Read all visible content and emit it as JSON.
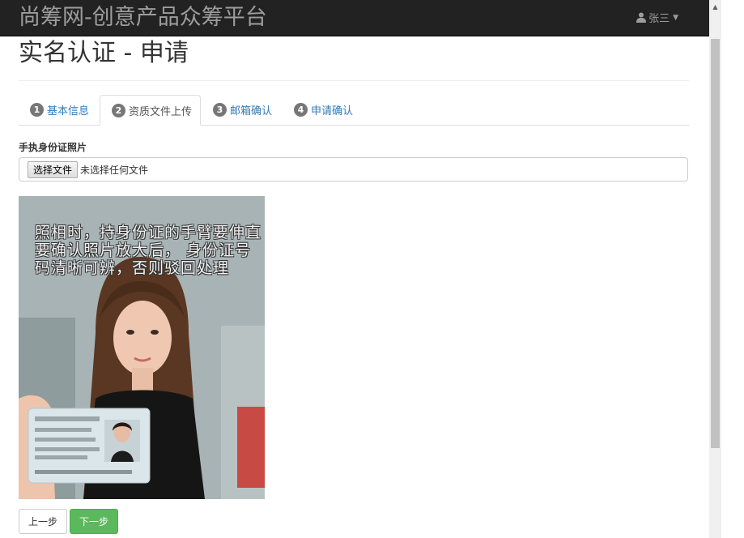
{
  "navbar": {
    "brand": "尚筹网-创意产品众筹平台",
    "user_name": "张三",
    "user_icon": "user-icon",
    "caret_icon": "caret-down-icon"
  },
  "page": {
    "title": "实名认证 - 申请"
  },
  "tabs": [
    {
      "number": "1",
      "label": "基本信息",
      "active": false
    },
    {
      "number": "2",
      "label": "资质文件上传",
      "active": true
    },
    {
      "number": "3",
      "label": "邮箱确认",
      "active": false
    },
    {
      "number": "4",
      "label": "申请确认",
      "active": false
    }
  ],
  "form": {
    "label": "手执身份证照片",
    "file_button": "选择文件",
    "file_status": "未选择任何文件"
  },
  "sample_photo": {
    "overlay_lines": [
      "照相时，持身份证的手臂要伸直",
      "要确认照片放大后， 身份证号",
      "码清晰可辨，否则驳回处理"
    ]
  },
  "buttons": {
    "prev": "上一步",
    "next": "下一步"
  },
  "colors": {
    "navbar_bg": "#222222",
    "link": "#337ab7",
    "success": "#5cb85c",
    "badge": "#777777"
  }
}
